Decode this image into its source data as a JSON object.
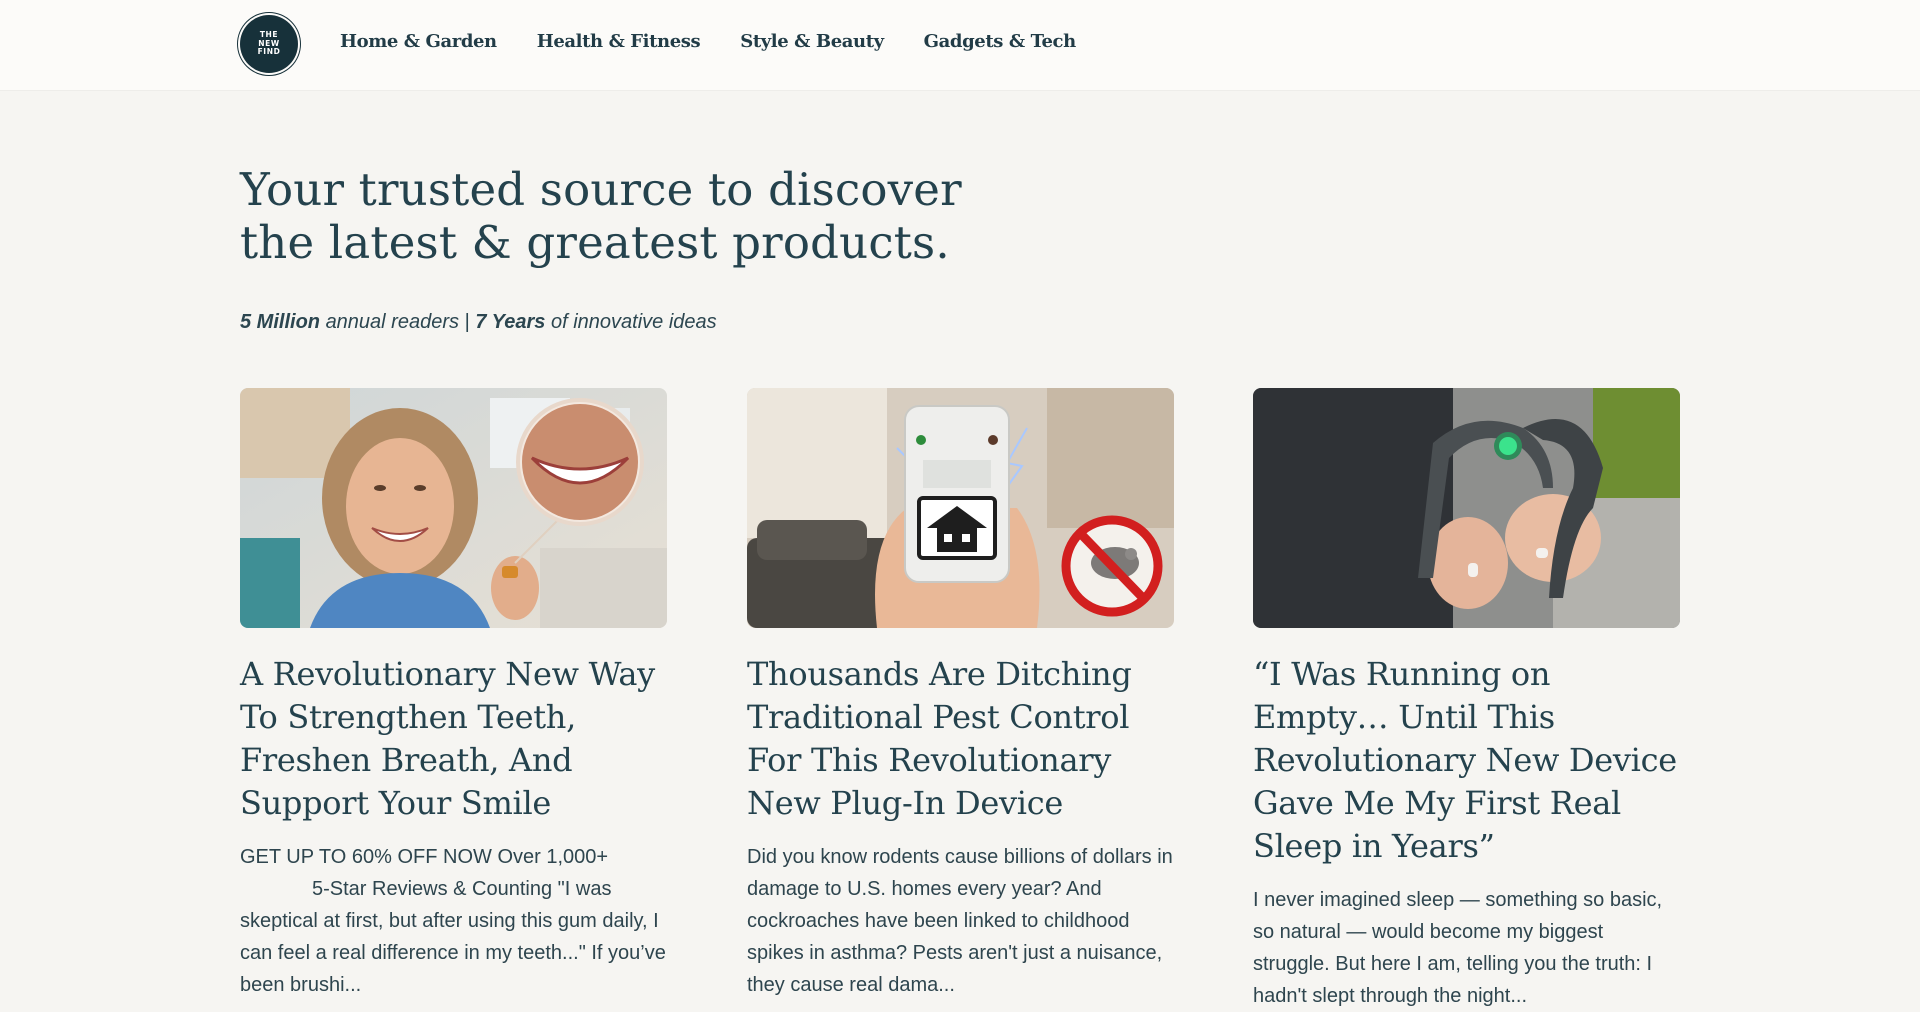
{
  "header": {
    "logo_lines": [
      "THE",
      "NEW",
      "FIND"
    ],
    "nav": [
      "Home & Garden",
      "Health & Fitness",
      "Style & Beauty",
      "Gadgets & Tech"
    ]
  },
  "hero": {
    "title_line1": "Your trusted source to discover",
    "title_line2": "the latest & greatest products.",
    "stat1_value": "5 Million",
    "stat1_label": "annual readers",
    "separator": "|",
    "stat2_value": "7 Years",
    "stat2_label": "of innovative ideas"
  },
  "articles": [
    {
      "title": "A Revolutionary New Way To Strengthen Teeth, Freshen Breath, And Support Your Smile",
      "excerpt_line1": "GET UP TO 60% OFF NOW Over 1,000+",
      "excerpt_rest": "5-Star Reviews & Counting \"I was skeptical at first, but after using this gum daily, I can feel a real difference in my teeth...\" If you’ve been brushi..."
    },
    {
      "title": "Thousands Are Ditching Traditional Pest Control For This Revolutionary New Plug-In Device",
      "excerpt": "Did you know rodents cause billions of dollars in damage to U.S. homes every year? And cockroaches have been linked to childhood spikes in asthma? Pests aren't just a nuisance, they cause real dama..."
    },
    {
      "title": "“I Was Running on Empty… Until This Revolutionary New Device Gave Me My First Real Sleep in Years”",
      "excerpt": "I never imagined sleep — something so basic, so natural — would become my biggest struggle. But here I am, telling you the truth: I hadn't slept through the night..."
    }
  ],
  "colors": {
    "page_bg": "#f6f5f2",
    "header_bg": "#fcfbf9",
    "text_primary": "#24424d",
    "logo_bg": "#17313a"
  }
}
